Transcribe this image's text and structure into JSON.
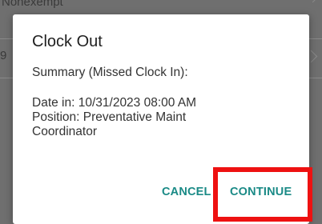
{
  "background": {
    "row1_text": "Nonexempt",
    "row2_text": "9"
  },
  "dialog": {
    "title": "Clock Out",
    "summary": "Summary (Missed Clock In):",
    "date_line": "Date in: 10/31/2023 08:00 AM",
    "position_line": "Position: Preventative Maint",
    "position_line_cont": "Coordinator",
    "cancel_label": "CANCEL",
    "continue_label": "CONTINUE"
  },
  "colors": {
    "accent": "#1a8a86",
    "highlight": "#ee1111",
    "overlay": "#6f6f6f"
  }
}
